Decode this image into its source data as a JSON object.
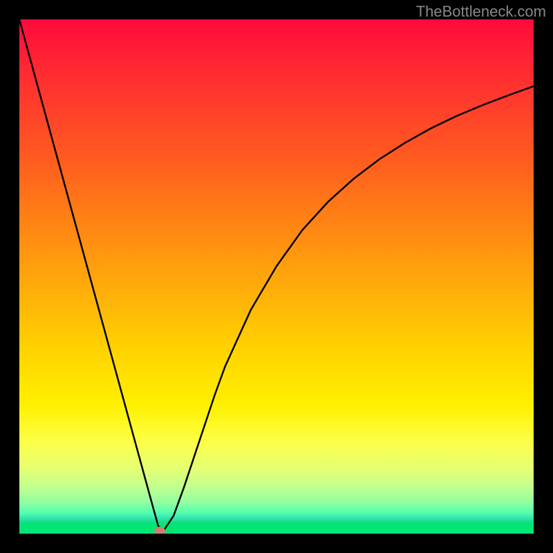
{
  "watermark": "TheBottleneck.com",
  "chart_data": {
    "type": "line",
    "title": "",
    "xlabel": "",
    "ylabel": "",
    "xlim": [
      0,
      100
    ],
    "ylim": [
      0,
      100
    ],
    "x": [
      0,
      2,
      4,
      6,
      8,
      10,
      12,
      14,
      16,
      18,
      20,
      22,
      24,
      26,
      27,
      28,
      30,
      32,
      34,
      36,
      38,
      40,
      45,
      50,
      55,
      60,
      65,
      70,
      75,
      80,
      85,
      90,
      95,
      100
    ],
    "values": [
      100,
      92.7,
      85.4,
      78.1,
      70.8,
      63.5,
      56.2,
      48.9,
      41.6,
      34.3,
      27.0,
      19.7,
      12.4,
      5.1,
      1.5,
      0.5,
      3.5,
      9.0,
      15.0,
      21.0,
      27.0,
      32.5,
      43.5,
      52.0,
      59.0,
      64.5,
      69.0,
      72.8,
      76.0,
      78.8,
      81.2,
      83.3,
      85.2,
      87.0
    ],
    "marker": {
      "x": 27.3,
      "y": 0.5,
      "color": "#d08070"
    },
    "gradient_colors": {
      "top": "#ff0a3c",
      "middle": "#ffd500",
      "bottom": "#00e676"
    }
  }
}
